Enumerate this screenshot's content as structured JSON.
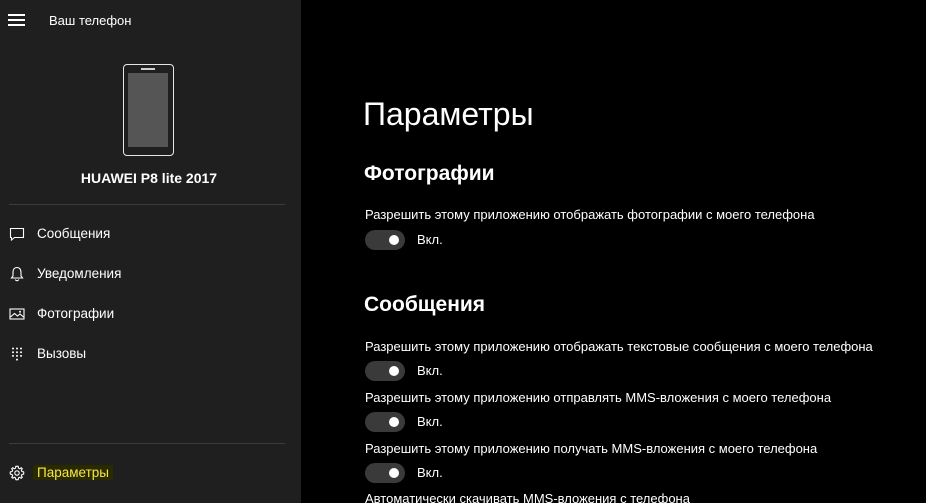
{
  "app": {
    "title": "Ваш телефон"
  },
  "device": {
    "name": "HUAWEI P8 lite 2017"
  },
  "sidebar": {
    "items": [
      {
        "label": "Сообщения",
        "icon": "chat-bubble-icon"
      },
      {
        "label": "Уведомления",
        "icon": "bell-icon"
      },
      {
        "label": "Фотографии",
        "icon": "photo-icon"
      },
      {
        "label": "Вызовы",
        "icon": "dialpad-icon"
      }
    ],
    "settings": {
      "label": "Параметры",
      "icon": "gear-icon",
      "active": true
    }
  },
  "main": {
    "title": "Параметры",
    "sections": [
      {
        "title": "Фотографии",
        "settings": [
          {
            "label": "Разрешить этому приложению отображать фотографии с моего телефона",
            "state": "Вкл.",
            "on": true
          }
        ]
      },
      {
        "title": "Сообщения",
        "settings": [
          {
            "label": "Разрешить этому приложению отображать текстовые сообщения с моего телефона",
            "state": "Вкл.",
            "on": true
          },
          {
            "label": "Разрешить этому приложению отправлять MMS-вложения с моего телефона",
            "state": "Вкл.",
            "on": true
          },
          {
            "label": "Разрешить этому приложению получать MMS-вложения с моего телефона",
            "state": "Вкл.",
            "on": true
          },
          {
            "label": "Автоматически скачивать MMS-вложения с телефона"
          }
        ]
      }
    ]
  },
  "colors": {
    "sidebar_bg": "#1f1f1f",
    "main_bg": "#000000",
    "accent_active": "#f5e64a",
    "toggle_bg": "#3a3a3a"
  }
}
